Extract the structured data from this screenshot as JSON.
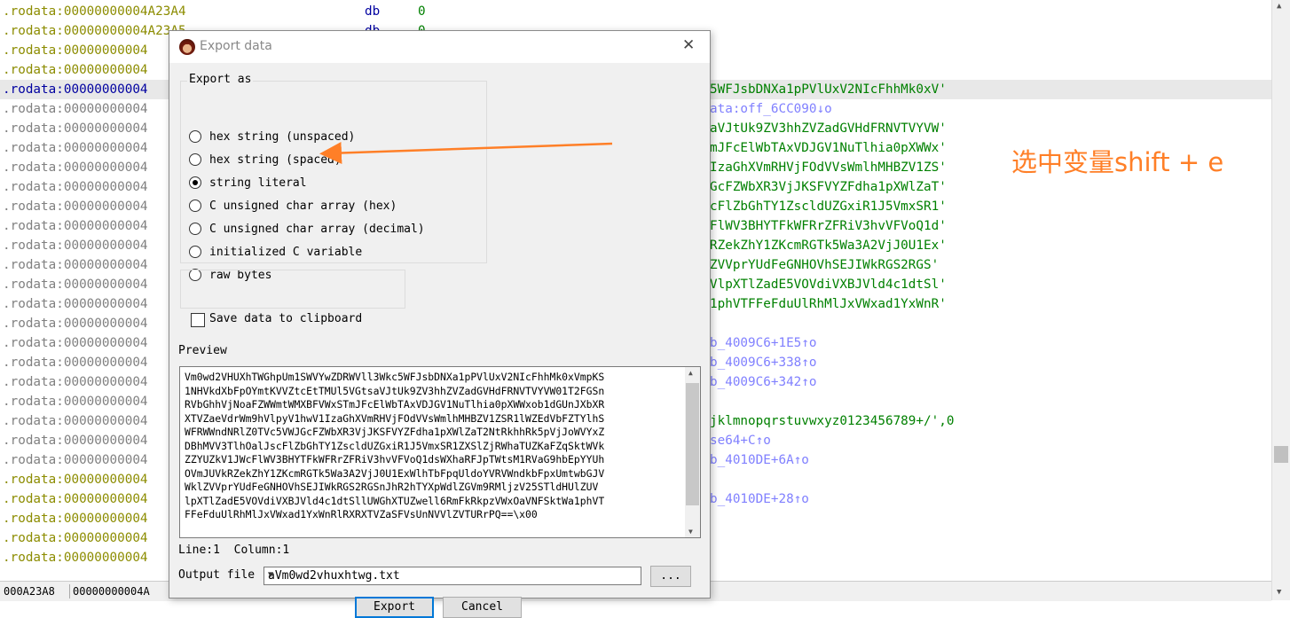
{
  "listing": {
    "rows": [
      {
        "addr": ".rodata:00000000004A23A4",
        "mnem": "db",
        "op": "0",
        "right": "",
        "right_class": "",
        "addr_class": ""
      },
      {
        "addr": ".rodata:00000000004A23A5",
        "mnem": "db",
        "op": "0",
        "right": "",
        "right_class": "",
        "addr_class": ""
      },
      {
        "addr": ".rodata:00000000004",
        "mnem": "",
        "op": "",
        "right": "",
        "right_class": "",
        "addr_class": ""
      },
      {
        "addr": ".rodata:00000000004",
        "mnem": "",
        "op": "",
        "right": "",
        "right_class": "",
        "addr_class": ""
      },
      {
        "addr": ".rodata:00000000004",
        "mnem": "",
        "op": "",
        "right": "5WFJsbDNXa1pPVlUxV2NIcFhhMk0xV'",
        "right_class": "str",
        "addr_class": "blue",
        "hl": true
      },
      {
        "addr": ".rodata:00000000004",
        "mnem": "",
        "op": "",
        "right": "ata:off_6CC090↓o",
        "right_class": "xref",
        "addr_class": "gray"
      },
      {
        "addr": ".rodata:00000000004",
        "mnem": "",
        "op": "",
        "right": "aVJtUk9ZV3hhZVZadGVHdFRNVTVYVW'",
        "right_class": "str",
        "addr_class": "gray"
      },
      {
        "addr": ".rodata:00000000004",
        "mnem": "",
        "op": "",
        "right": "mJFcElWbTAxVDJGV1NuTlhia0pXWWx'",
        "right_class": "str",
        "addr_class": "gray"
      },
      {
        "addr": ".rodata:00000000004",
        "mnem": "",
        "op": "",
        "right": "IzaGhXVmRHVjFOdVVsWmlhMHBZV1ZS'",
        "right_class": "str",
        "addr_class": "gray"
      },
      {
        "addr": ".rodata:00000000004",
        "mnem": "",
        "op": "",
        "right": "GcFZWbXR3VjJKSFVYZFdha1pXWlZaT'",
        "right_class": "str",
        "addr_class": "gray"
      },
      {
        "addr": ".rodata:00000000004",
        "mnem": "",
        "op": "",
        "right": "cFlZbGhTY1ZscldUZGxiR1J5VmxSR1'",
        "right_class": "str",
        "addr_class": "gray"
      },
      {
        "addr": ".rodata:00000000004",
        "mnem": "",
        "op": "",
        "right": "FlWV3BHYTFkWFRrZFRiV3hvVFVoQ1d'",
        "right_class": "str",
        "addr_class": "gray"
      },
      {
        "addr": ".rodata:00000000004",
        "mnem": "",
        "op": "",
        "right": "RZekZhY1ZKcmRGTk5Wa3A2VjJ0U1Ex'",
        "right_class": "str",
        "addr_class": "gray"
      },
      {
        "addr": ".rodata:00000000004",
        "mnem": "",
        "op": "",
        "right": "ZVVprYUdFeGNHOVhSEJIWkRGS2RGS'",
        "right_class": "str",
        "addr_class": "gray"
      },
      {
        "addr": ".rodata:00000000004",
        "mnem": "",
        "op": "",
        "right": "VlpXTlZadE5VOVdiVXBJVld4c1dtSl'",
        "right_class": "str",
        "addr_class": "gray"
      },
      {
        "addr": ".rodata:00000000004",
        "mnem": "",
        "op": "",
        "right": "1phVTFFeFduUlRhMlJxVWxad1YxWnR'",
        "right_class": "str",
        "addr_class": "gray"
      },
      {
        "addr": ".rodata:00000000004",
        "mnem": "",
        "op": "",
        "right": "",
        "right_class": "",
        "addr_class": "gray"
      },
      {
        "addr": ".rodata:00000000004",
        "mnem": "",
        "op": "",
        "right": "b_4009C6+1E5↑o",
        "right_class": "xref",
        "addr_class": "gray"
      },
      {
        "addr": ".rodata:00000000004",
        "mnem": "",
        "op": "",
        "right": "b_4009C6+338↑o",
        "right_class": "xref",
        "addr_class": "gray"
      },
      {
        "addr": ".rodata:00000000004",
        "mnem": "",
        "op": "",
        "right": "b_4009C6+342↑o",
        "right_class": "xref",
        "addr_class": "gray"
      },
      {
        "addr": ".rodata:00000000004",
        "mnem": "",
        "op": "",
        "right": "",
        "right_class": "",
        "addr_class": "gray"
      },
      {
        "addr": ".rodata:00000000004",
        "mnem": "",
        "op": "",
        "right": "jklmnopqrstuvwxyz0123456789+/',0",
        "right_class": "str",
        "addr_class": "gray"
      },
      {
        "addr": ".rodata:00000000004",
        "mnem": "",
        "op": "",
        "right": "se64+C↑o",
        "right_class": "xref",
        "addr_class": "gray"
      },
      {
        "addr": ".rodata:00000000004",
        "mnem": "",
        "op": "",
        "right": "b_4010DE+6A↑o",
        "right_class": "xref",
        "addr_class": "gray"
      },
      {
        "addr": ".rodata:00000000004",
        "mnem": "",
        "op": "",
        "right": "",
        "right_class": "",
        "addr_class": ""
      },
      {
        "addr": ".rodata:00000000004",
        "mnem": "",
        "op": "",
        "right": "b_4010DE+28↑o",
        "right_class": "xref",
        "addr_class": ""
      },
      {
        "addr": ".rodata:00000000004",
        "mnem": "",
        "op": "",
        "right": "",
        "right_class": "",
        "addr_class": ""
      },
      {
        "addr": ".rodata:00000000004",
        "mnem": "",
        "op": "",
        "right": "",
        "right_class": "",
        "addr_class": ""
      },
      {
        "addr": ".rodata:00000000004",
        "mnem": "",
        "op": "",
        "right": "",
        "right_class": "",
        "addr_class": ""
      }
    ]
  },
  "status_bar": {
    "offset": "000A23A8",
    "address": "00000000004A"
  },
  "annotation": {
    "text": "选中变量shift + e"
  },
  "dialog": {
    "title": "Export data",
    "close_glyph": "✕",
    "export_as_label": "Export as",
    "options": [
      {
        "label": "hex string (unspaced)",
        "selected": false
      },
      {
        "label": "hex string (spaced)",
        "selected": false
      },
      {
        "label": "string literal",
        "selected": true
      },
      {
        "label": "C unsigned char array (hex)",
        "selected": false
      },
      {
        "label": "C unsigned char array (decimal)",
        "selected": false
      },
      {
        "label": "initialized C variable",
        "selected": false
      },
      {
        "label": "raw bytes",
        "selected": false
      }
    ],
    "save_clipboard_label": "Save data to clipboard",
    "save_clipboard_checked": false,
    "preview_label": "Preview",
    "preview_text": "Vm0wd2VHUXhTWGhpUm1SWVYwZDRWVll3Wkc5WFJsbDNXa1pPVlUxV2NIcFhhMk0xVmpKS\n1NHVkdXbFpOYmtKVVZtcEtTMUl5VGtsaVJtUk9ZV3hhZVZadGVHdFRNVTVYVW01T2FGSn\nRVbGhhVjNoaFZWWmtWMXBFVWxSTmJFcElWbTAxVDJGV1NuTlhia0pXWWxob1dGUnJXbXR\nXTVZaeVdrWm9hVlpyV1hwV1IzaGhXVmRHVjFOdVVsWmlhMHBZV1ZSR1lWZEdVbFZTYlhS\nWFRWWndNRlZ0TVc5VWJGcFZWbXR3VjJKSFVYZFdha1pXWlZaT2NtRkhhRk5pVjJoWVYxZ\nDBhMVV3TlhOalJscFlZbGhTY1ZscldUZGxiR1J5VmxSR1ZXSlZjRWhaTUZKaFZqSktWVk\nZZYUZkV1JWcFlWV3BHYTFkWFRrZFRiV3hvVFVoQ1dsWXhaRFJpTWtsM1RVaG9hbEpYYUh\nOVmJUVkRZekZhY1ZKcmRGTk5Wa3A2VjJ0U1ExWlhTbFpqUldoYVRVWndkbFpxUmtwbGJV\nWklZVVprYUdFeGNHOVhSEJIWkRGS2RGSnJhR2hTYXpWdlZGVm9RMljzV25STldHUlZUV\nlpXTlZadE5VOVdiVXBJVld4c1dtSllUWGhXTUZwell6RmFkRkpzVWxOaVNFSktWa1phVT\nFFeFduUlRhMlJxVWxad1YxWnRlRXRXTVZaSFVsUnNVVlZVTURrPQ==\\x00",
    "line_label": "Line:",
    "line_value": "1",
    "column_label": "Column:",
    "column_value": "1",
    "output_file_label": "Output file",
    "output_file_value": "aVm0wd2vhuxhtwg.txt",
    "browse_label": "...",
    "export_button": "Export",
    "cancel_button": "Cancel"
  },
  "colors": {
    "accent_orange": "#ff7f27",
    "string_green": "#008000",
    "xref_blue": "#8080ff",
    "dialog_bg": "#f0f0f0"
  },
  "icons": {
    "app": "ida-app-icon",
    "close": "close-icon",
    "dropdown": "chevron-down-icon"
  }
}
